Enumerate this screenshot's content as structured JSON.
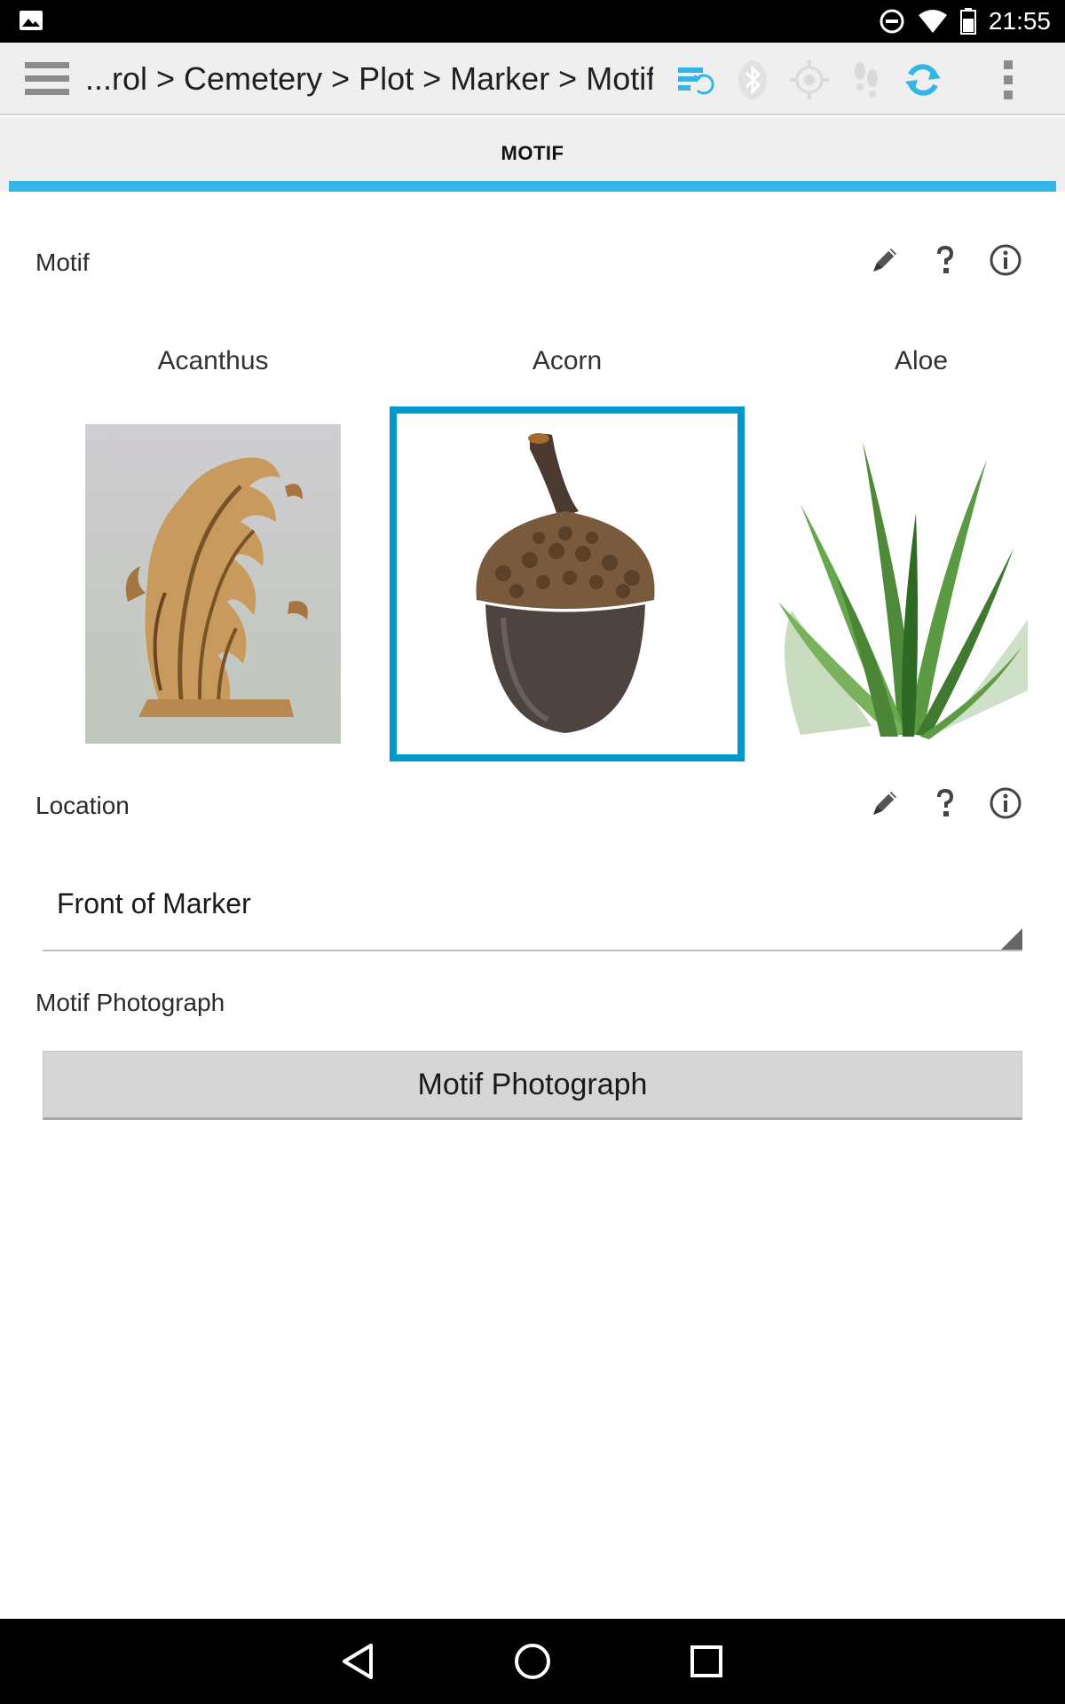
{
  "status_bar": {
    "time": "21:55",
    "icons": [
      "gallery-notification-icon",
      "do-not-disturb-icon",
      "wifi-icon",
      "battery-icon"
    ]
  },
  "app_bar": {
    "breadcrumb": "...rol > Cemetery > Plot > Marker > Motif",
    "icons": [
      "menu-icon",
      "data-sync-icon",
      "bluetooth-icon",
      "gps-icon",
      "footsteps-icon",
      "refresh-icon",
      "overflow-menu-icon"
    ],
    "accent_color": "#33b5e5"
  },
  "tab": {
    "label": "MOTIF"
  },
  "motif_field": {
    "label": "Motif",
    "options": [
      {
        "name": "Acanthus",
        "selected": false
      },
      {
        "name": "Acorn",
        "selected": true
      },
      {
        "name": "Aloe",
        "selected": false
      }
    ]
  },
  "location_field": {
    "label": "Location",
    "value": "Front of Marker"
  },
  "photo_field": {
    "label": "Motif Photograph",
    "button_label": "Motif Photograph"
  },
  "nav_bar": {
    "icons": [
      "back-icon",
      "home-icon",
      "recents-icon"
    ]
  }
}
